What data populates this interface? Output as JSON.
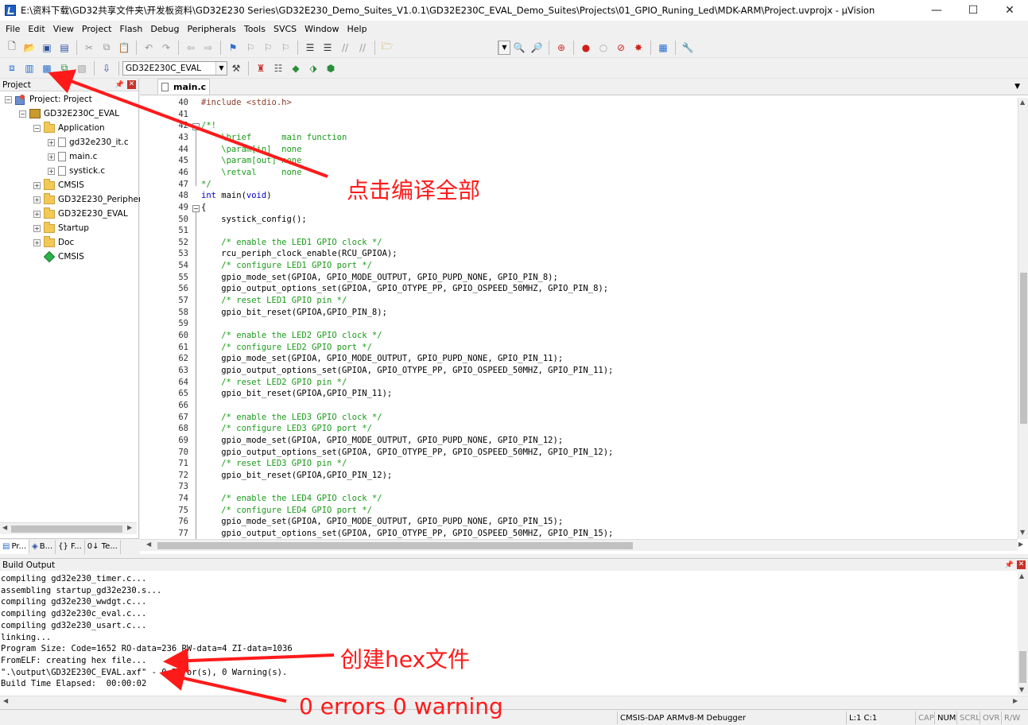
{
  "window": {
    "title": "E:\\资料下载\\GD32共享文件夹\\开发板资料\\GD32E230 Series\\GD32E230_Demo_Suites_V1.0.1\\GD32E230C_EVAL_Demo_Suites\\Projects\\01_GPIO_Runing_Led\\MDK-ARM\\Project.uvprojx - µVision",
    "minimize": "—",
    "maximize": "☐",
    "close": "✕"
  },
  "menu": [
    "File",
    "Edit",
    "View",
    "Project",
    "Flash",
    "Debug",
    "Peripherals",
    "Tools",
    "SVCS",
    "Window",
    "Help"
  ],
  "toolbar": {
    "target_combo": "GD32E230C_EVAL"
  },
  "project_panel": {
    "title": "Project",
    "tree": [
      {
        "label": "Project: Project",
        "level": 0,
        "kind": "project",
        "expander": "−"
      },
      {
        "label": "GD32E230C_EVAL",
        "level": 1,
        "kind": "target",
        "expander": "−"
      },
      {
        "label": "Application",
        "level": 2,
        "kind": "folder",
        "expander": "−"
      },
      {
        "label": "gd32e230_it.c",
        "level": 3,
        "kind": "file",
        "expander": "+"
      },
      {
        "label": "main.c",
        "level": 3,
        "kind": "file",
        "expander": "+"
      },
      {
        "label": "systick.c",
        "level": 3,
        "kind": "file",
        "expander": "+"
      },
      {
        "label": "CMSIS",
        "level": 2,
        "kind": "folder",
        "expander": "+"
      },
      {
        "label": "GD32E230_Peripherals",
        "level": 2,
        "kind": "folder",
        "expander": "+"
      },
      {
        "label": "GD32E230_EVAL",
        "level": 2,
        "kind": "folder",
        "expander": "+"
      },
      {
        "label": "Startup",
        "level": 2,
        "kind": "folder",
        "expander": "+"
      },
      {
        "label": "Doc",
        "level": 2,
        "kind": "folder",
        "expander": "+"
      },
      {
        "label": "CMSIS",
        "level": 2,
        "kind": "component",
        "expander": ""
      }
    ],
    "tabs": [
      "Pr...",
      "B...",
      "{} F...",
      "0↓ Te..."
    ]
  },
  "editor": {
    "tab": "main.c",
    "first_line": 40,
    "lines": [
      [
        [
          "pp",
          "#include <stdio.h>"
        ]
      ],
      [],
      [
        [
          "cm",
          "/*!"
        ]
      ],
      [
        [
          "cm",
          "    \\brief      main function"
        ]
      ],
      [
        [
          "cm",
          "    \\param[in]  none"
        ]
      ],
      [
        [
          "cm",
          "    \\param[out] none"
        ]
      ],
      [
        [
          "cm",
          "    \\retval     none"
        ]
      ],
      [
        [
          "cm",
          "*/"
        ]
      ],
      [
        [
          "kw",
          "int"
        ],
        [
          "n",
          " main("
        ],
        [
          "kw",
          "void"
        ],
        [
          "n",
          ")"
        ]
      ],
      [
        [
          "n",
          "{"
        ]
      ],
      [
        [
          "n",
          "    systick_config();"
        ]
      ],
      [],
      [
        [
          "cm",
          "    /* enable the LED1 GPIO clock */"
        ]
      ],
      [
        [
          "n",
          "    rcu_periph_clock_enable(RCU_GPIOA);"
        ]
      ],
      [
        [
          "cm",
          "    /* configure LED1 GPIO port */"
        ]
      ],
      [
        [
          "n",
          "    gpio_mode_set(GPIOA, GPIO_MODE_OUTPUT, GPIO_PUPD_NONE, GPIO_PIN_8);"
        ]
      ],
      [
        [
          "n",
          "    gpio_output_options_set(GPIOA, GPIO_OTYPE_PP, GPIO_OSPEED_50MHZ, GPIO_PIN_8);"
        ]
      ],
      [
        [
          "cm",
          "    /* reset LED1 GPIO pin */"
        ]
      ],
      [
        [
          "n",
          "    gpio_bit_reset(GPIOA,GPIO_PIN_8);"
        ]
      ],
      [],
      [
        [
          "cm",
          "    /* enable the LED2 GPIO clock */"
        ]
      ],
      [
        [
          "cm",
          "    /* configure LED2 GPIO port */"
        ]
      ],
      [
        [
          "n",
          "    gpio_mode_set(GPIOA, GPIO_MODE_OUTPUT, GPIO_PUPD_NONE, GPIO_PIN_11);"
        ]
      ],
      [
        [
          "n",
          "    gpio_output_options_set(GPIOA, GPIO_OTYPE_PP, GPIO_OSPEED_50MHZ, GPIO_PIN_11);"
        ]
      ],
      [
        [
          "cm",
          "    /* reset LED2 GPIO pin */"
        ]
      ],
      [
        [
          "n",
          "    gpio_bit_reset(GPIOA,GPIO_PIN_11);"
        ]
      ],
      [],
      [
        [
          "cm",
          "    /* enable the LED3 GPIO clock */"
        ]
      ],
      [
        [
          "cm",
          "    /* configure LED3 GPIO port */"
        ]
      ],
      [
        [
          "n",
          "    gpio_mode_set(GPIOA, GPIO_MODE_OUTPUT, GPIO_PUPD_NONE, GPIO_PIN_12);"
        ]
      ],
      [
        [
          "n",
          "    gpio_output_options_set(GPIOA, GPIO_OTYPE_PP, GPIO_OSPEED_50MHZ, GPIO_PIN_12);"
        ]
      ],
      [
        [
          "cm",
          "    /* reset LED3 GPIO pin */"
        ]
      ],
      [
        [
          "n",
          "    gpio_bit_reset(GPIOA,GPIO_PIN_12);"
        ]
      ],
      [],
      [
        [
          "cm",
          "    /* enable the LED4 GPIO clock */"
        ]
      ],
      [
        [
          "cm",
          "    /* configure LED4 GPIO port */"
        ]
      ],
      [
        [
          "n",
          "    gpio_mode_set(GPIOA, GPIO_MODE_OUTPUT, GPIO_PUPD_NONE, GPIO_PIN_15);"
        ]
      ],
      [
        [
          "n",
          "    gpio_output_options_set(GPIOA, GPIO_OTYPE_PP, GPIO_OSPEED_50MHZ, GPIO_PIN_15);"
        ]
      ]
    ]
  },
  "build_output": {
    "title": "Build Output",
    "lines": [
      "compiling gd32e230_timer.c...",
      "assembling startup_gd32e230.s...",
      "compiling gd32e230_wwdgt.c...",
      "compiling gd32e230c_eval.c...",
      "compiling gd32e230_usart.c...",
      "linking...",
      "Program Size: Code=1652 RO-data=236 RW-data=4 ZI-data=1036",
      "FromELF: creating hex file...",
      "\".\\output\\GD32E230C_EVAL.axf\" - 0 Error(s), 0 Warning(s).",
      "Build Time Elapsed:  00:00:02"
    ]
  },
  "status_bar": {
    "debugger": "CMSIS-DAP ARMv8-M Debugger",
    "position": "L:1 C:1",
    "cap": "CAP",
    "num": "NUM",
    "scrl": "SCRL",
    "ovr": "OVR",
    "rw": "R/W"
  },
  "annotations": {
    "compile_all": "点击编译全部",
    "create_hex": "创建hex文件",
    "errors_warnings": "0 errors  0 warning",
    "color": "#ff1a1a"
  }
}
